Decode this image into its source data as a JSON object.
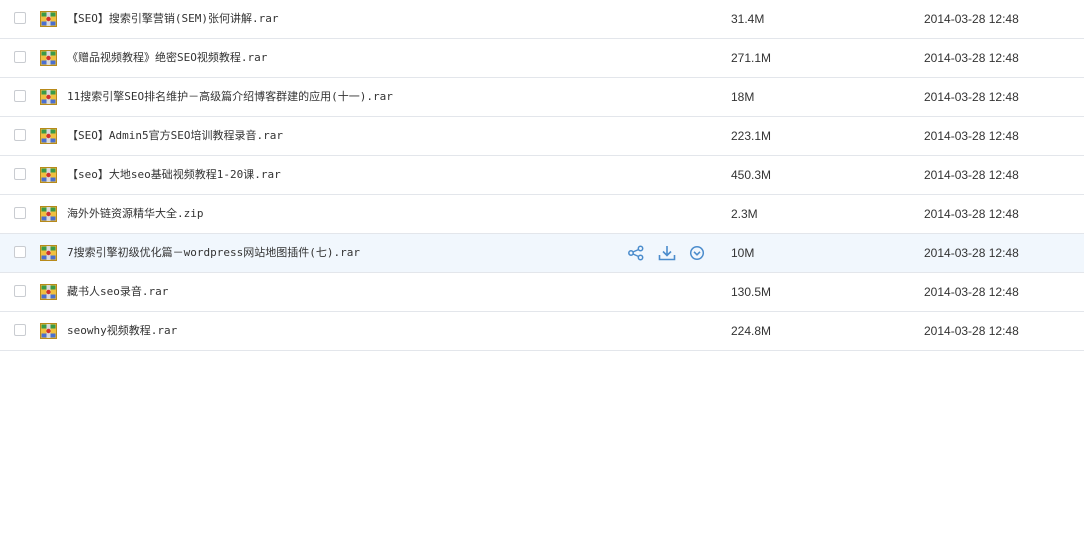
{
  "files": [
    {
      "name": "【SEO】搜索引擎营销(SEM)张何讲解.rar",
      "size": "31.4M",
      "date": "2014-03-28 12:48",
      "icon": "rar-archive-icon"
    },
    {
      "name": "《赠品视频教程》绝密SEO视频教程.rar",
      "size": "271.1M",
      "date": "2014-03-28 12:48",
      "icon": "rar-archive-icon"
    },
    {
      "name": "11搜索引擎SEO排名维护－高级篇介绍博客群建的应用(十一).rar",
      "size": "18M",
      "date": "2014-03-28 12:48",
      "icon": "rar-archive-icon"
    },
    {
      "name": "【SEO】Admin5官方SEO培训教程录音.rar",
      "size": "223.1M",
      "date": "2014-03-28 12:48",
      "icon": "rar-archive-icon"
    },
    {
      "name": "【seo】大地seo基础视频教程1-20课.rar",
      "size": "450.3M",
      "date": "2014-03-28 12:48",
      "icon": "rar-archive-icon"
    },
    {
      "name": "海外外链资源精华大全.zip",
      "size": "2.3M",
      "date": "2014-03-28 12:48",
      "icon": "zip-archive-icon"
    },
    {
      "name": "7搜索引擎初级优化篇－wordpress网站地图插件(七).rar",
      "size": "10M",
      "date": "2014-03-28 12:48",
      "icon": "rar-archive-icon",
      "hovered": true
    },
    {
      "name": "藏书人seo录音.rar",
      "size": "130.5M",
      "date": "2014-03-28 12:48",
      "icon": "rar-archive-icon"
    },
    {
      "name": "seowhy视频教程.rar",
      "size": "224.8M",
      "date": "2014-03-28 12:48",
      "icon": "rar-archive-icon"
    }
  ],
  "row_actions": [
    {
      "icon": "share-icon"
    },
    {
      "icon": "download-icon"
    },
    {
      "icon": "more-dropdown-icon"
    }
  ],
  "colors": {
    "hover_row_bg": "#f1f7fd",
    "row_border": "#e3e6eb",
    "action_icon": "#4b8ccc",
    "text": "#333333"
  }
}
